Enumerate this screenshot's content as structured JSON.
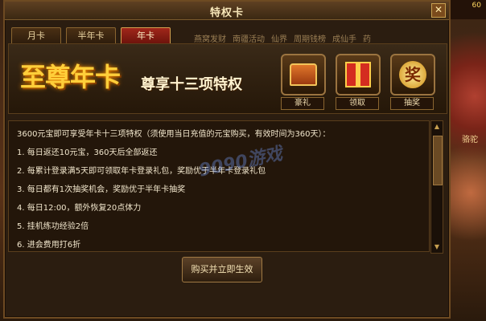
{
  "window": {
    "title": "特权卡",
    "close_label": "✕"
  },
  "tabs": [
    {
      "label": "月卡",
      "active": false
    },
    {
      "label": "半年卡",
      "active": false
    },
    {
      "label": "年卡",
      "active": true
    }
  ],
  "background": {
    "top_right_value": "60",
    "side_label": "骆驼",
    "nav_labels": [
      "燕窝发财",
      "南疆活动",
      "仙界",
      "周期钱榜",
      "成仙手",
      "药"
    ]
  },
  "banner": {
    "logo_text": "至尊年卡",
    "slogan": "尊享十三项特权",
    "rewards": [
      {
        "label": "豪礼",
        "icon": "treasure-chest-icon"
      },
      {
        "label": "领取",
        "icon": "gift-box-icon"
      },
      {
        "label": "抽奖",
        "icon": "lottery-icon",
        "glyph": "奖"
      }
    ]
  },
  "content": {
    "intro": "3600元宝即可享受年卡十三项特权（须使用当日充值的元宝购买，有效时间为360天）：",
    "items": [
      "1. 每日返还10元宝，360天后全部返还",
      "2. 每累计登录满5天即可领取年卡登录礼包，奖励优于半年卡登录礼包",
      "3. 每日都有1次抽奖机会，奖励优于半年卡抽奖",
      "4. 每日12:00，额外恢复20点体力",
      "5. 挂机练功经验2倍",
      "6. 进会费用打6折"
    ],
    "watermark": "9090游戏"
  },
  "actions": {
    "buy_label": "购买并立即生效"
  },
  "colors": {
    "accent": "#a0261a",
    "gold": "#ffcf3a",
    "frame": "#6d4a22"
  }
}
